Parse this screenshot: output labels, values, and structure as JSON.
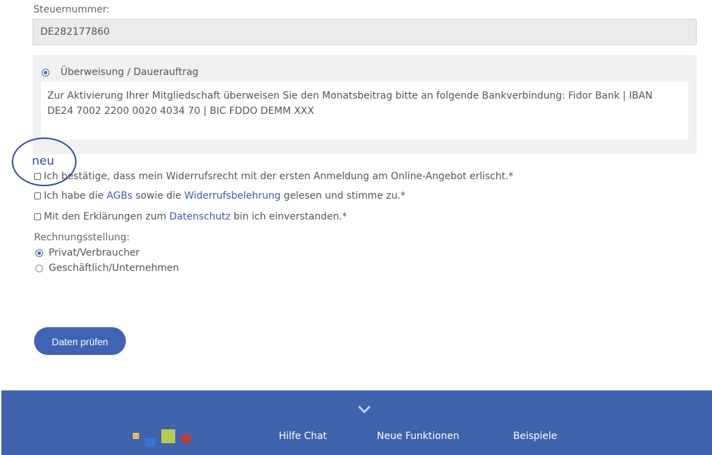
{
  "tax": {
    "label": "Steuernummer:",
    "value": "DE282177860"
  },
  "payment": {
    "option_label": "Überweisung / Dauerauftrag",
    "selected": true,
    "bank_text": "Zur Aktivierung Ihrer Mitgliedschaft überweisen Sie den Monatsbeitrag bitte an folgende Bankverbindung: Fidor Bank | IBAN DE24 7002 2200 0020 4034 70 | BIC FDDO DEMM XXX"
  },
  "annotation": {
    "text": "neu",
    "color": "#2d45b8"
  },
  "consents": {
    "withdrawal": {
      "text": "Ich bestätige, dass mein Widerrufsrecht mit der ersten Anmeldung am Online-Angebot erlischt.*",
      "checked": false
    },
    "terms": {
      "prefix": "Ich habe die ",
      "agb_link": "AGBs",
      "middle": " sowie die ",
      "widerruf_link": "Widerrufsbelehrung",
      "suffix": " gelesen und stimme zu.*",
      "checked": false
    },
    "privacy": {
      "prefix": "Mit den Erklärungen zum ",
      "link": "Datenschutz",
      "suffix": " bin ich einverstanden.*",
      "checked": false
    }
  },
  "billing": {
    "label": "Rechnungsstellung:",
    "options": [
      {
        "label": "Privat/Verbraucher",
        "selected": true
      },
      {
        "label": "Geschäftlich/Unternehmen",
        "selected": false
      }
    ]
  },
  "submit": {
    "label": "Daten prüfen"
  },
  "footer": {
    "chevron_icon": "chevron-down-icon",
    "logo": "colored-squares-logo",
    "links": [
      "Hilfe Chat",
      "Neue Funktionen",
      "Beispiele"
    ]
  },
  "colors": {
    "accent": "#3f63b5",
    "footer_bg": "#4063ae",
    "link": "#3f5ba8"
  }
}
